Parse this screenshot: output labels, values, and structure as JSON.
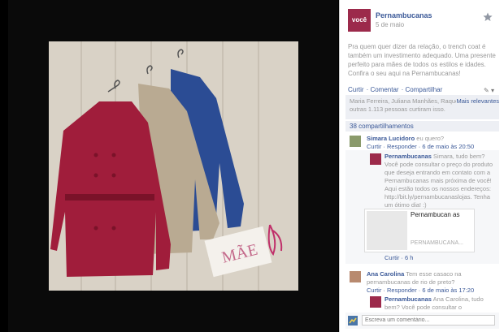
{
  "post": {
    "logo_text": "você",
    "page_name": "Pernambucanas",
    "time": "5 de maio",
    "caption": "Pra quem quer dizer da relação, o trench coat é também um investimento adequado. Uma presente perfeito para mães de todos os estilos e idades. Confira o seu aqui na Pernambucanas!",
    "actions": [
      "Curtir",
      "Comentar",
      "Compartilhar"
    ],
    "likes": "Maria Ferreira, Juliana Manhães, Raquel Muniz e outras 1.113 pessoas curtiram isso.",
    "relevant_label": "Mais relevantes",
    "shares": "38 compartilhamentos"
  },
  "comments": [
    {
      "name": "Simara Lucidoro",
      "text": "eu quero?",
      "meta": "Curtir · Responder · 6 de maio às 20:50"
    },
    {
      "name": "Pernambucanas",
      "text": "Simara, tudo bem? Você pode consultar o preço do produto que deseja entrando em contato com a Pernambucanas mais próxima de você! Aqui estão todos os nossos endereços: http://bit.ly/pernambucanaslojas. Tenha um ótimo dia! :)",
      "meta": "Curtir · 6 h"
    },
    {
      "name": "Ana Carolina",
      "text": "Tem esse casaco na pernambucanas de rio de preto?",
      "meta": "Curtir · Responder · 6 de maio às 17:20"
    },
    {
      "name": "Pernambucanas",
      "text": "Ana Carolina, tudo bem? Você pode consultar o",
      "meta": ""
    }
  ],
  "preview": {
    "title": "Pernambucan as",
    "sub": "PERNAMBUCANA..."
  },
  "write_placeholder": "Escreva um comentário...",
  "card_text": "MÃE",
  "colors": {
    "fb_blue": "#3b5998",
    "coat_red": "#a01d3b",
    "coat_beige": "#b9aa92",
    "coat_blue": "#2b4c94"
  }
}
